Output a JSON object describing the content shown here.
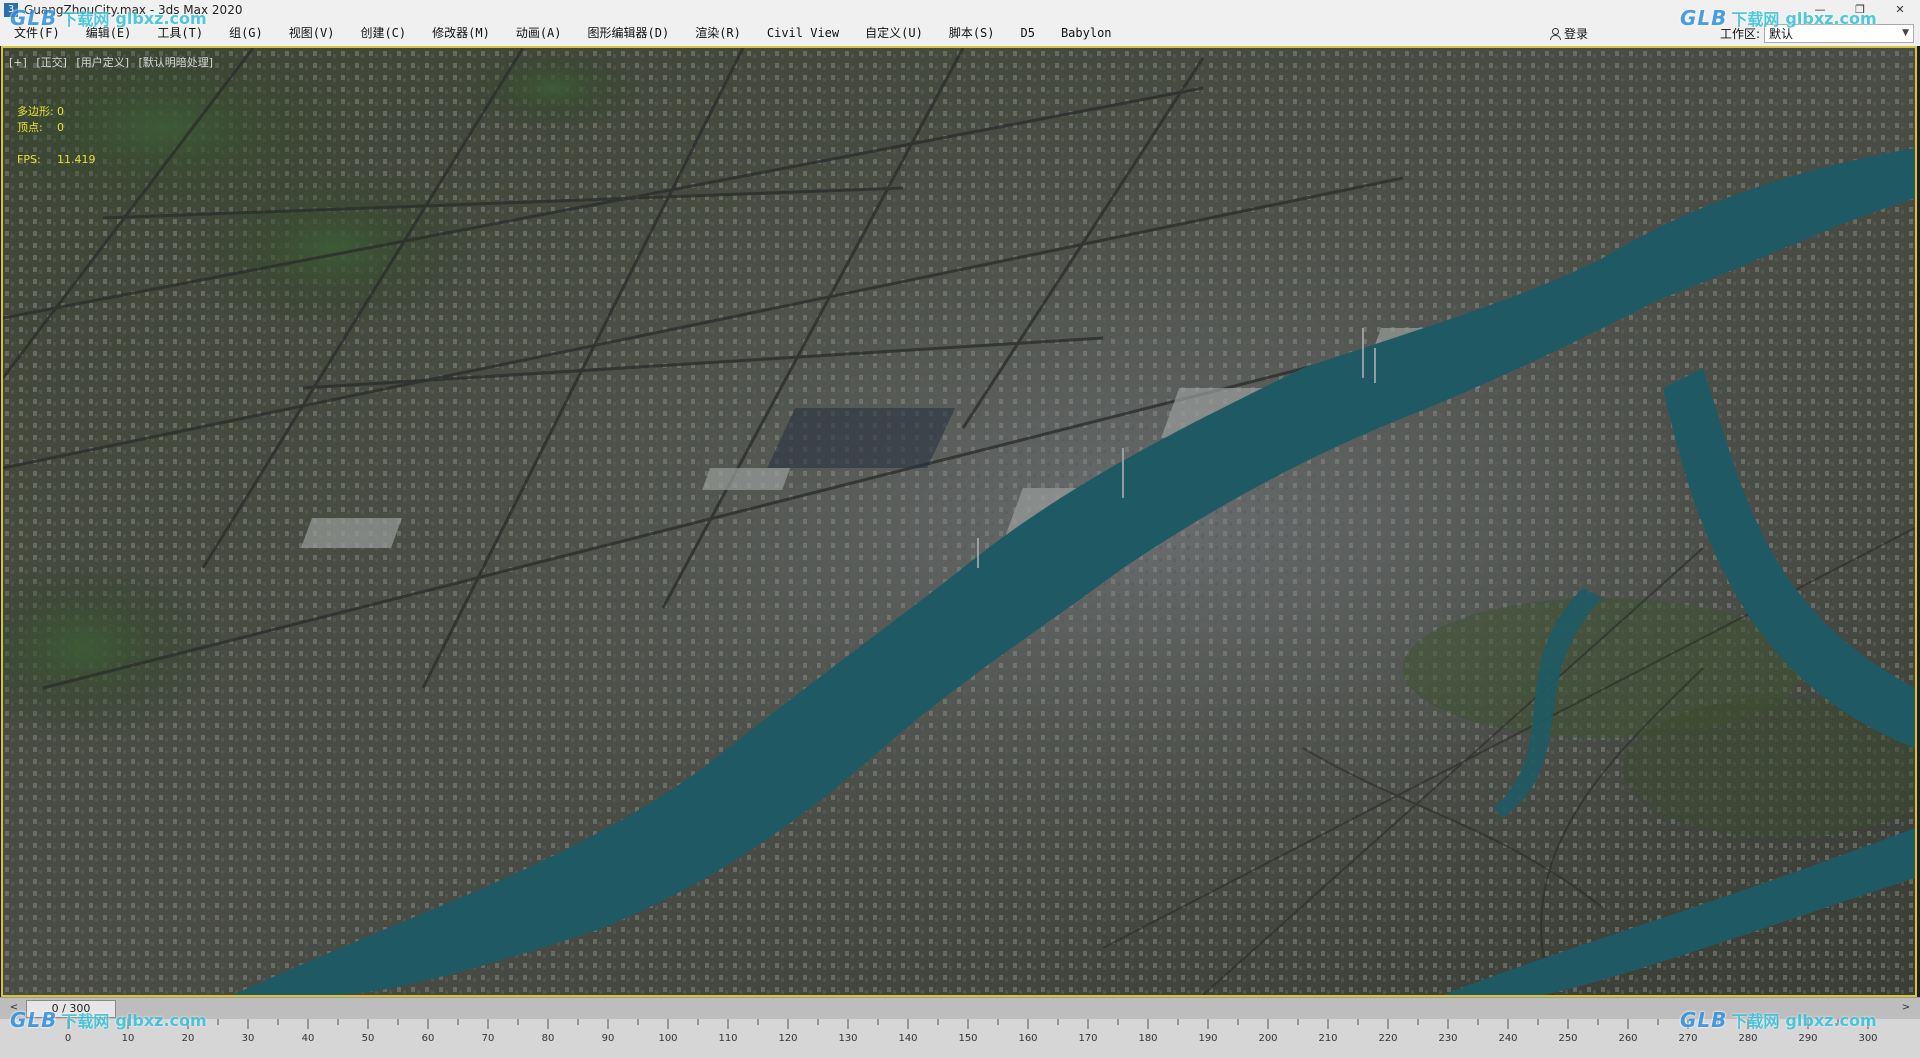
{
  "window": {
    "title": "GuangZhouCity.max - 3ds Max 2020",
    "app_icon": "3ds-max-icon",
    "controls": [
      "minimize",
      "maximize",
      "close"
    ],
    "control_glyphs": [
      "—",
      "❐",
      "✕"
    ]
  },
  "menubar": {
    "items": [
      "文件(F)",
      "编辑(E)",
      "工具(T)",
      "组(G)",
      "视图(V)",
      "创建(C)",
      "修改器(M)",
      "动画(A)",
      "图形编辑器(D)",
      "渲染(R)",
      "Civil View",
      "自定义(U)",
      "脚本(S)",
      "D5",
      "Babylon"
    ],
    "login_label": "登录",
    "workspace_label": "工作区:",
    "workspace_value": "默认"
  },
  "viewport": {
    "labels": [
      "[+]",
      "[正交]",
      "[用户定义]",
      "[默认明暗处理]"
    ],
    "stats": {
      "polygons_label": "多边形:",
      "polygons_value": "0",
      "vertices_label": "顶点:",
      "vertices_value": "0",
      "fps_label": "FPS:",
      "fps_value": "11.419"
    },
    "border_color": "#d8c43a",
    "stats_color": "#e8e030"
  },
  "timeline": {
    "slider_label": "0 / 300",
    "prev_glyph": "<",
    "next_glyph": ">",
    "current_frame": 0,
    "total_frames": 300,
    "tick_labels": [
      "0",
      "10",
      "20",
      "30",
      "40",
      "50",
      "60",
      "70",
      "80",
      "90",
      "100",
      "110",
      "120",
      "130",
      "140",
      "150",
      "160",
      "170",
      "180",
      "190",
      "200",
      "210",
      "220",
      "230",
      "240",
      "250",
      "260",
      "270",
      "280",
      "290",
      "300"
    ]
  },
  "watermarks": [
    {
      "logo": "GLB",
      "name": "下载网",
      "site": "glbxz.com"
    },
    {
      "logo": "GLB",
      "name": "下载网",
      "site": "glbxz.com"
    },
    {
      "logo": "GLB",
      "name": "下载网",
      "site": "glbxz.com"
    },
    {
      "logo": "GLB",
      "name": "下载网",
      "site": "glbxz.com"
    }
  ]
}
